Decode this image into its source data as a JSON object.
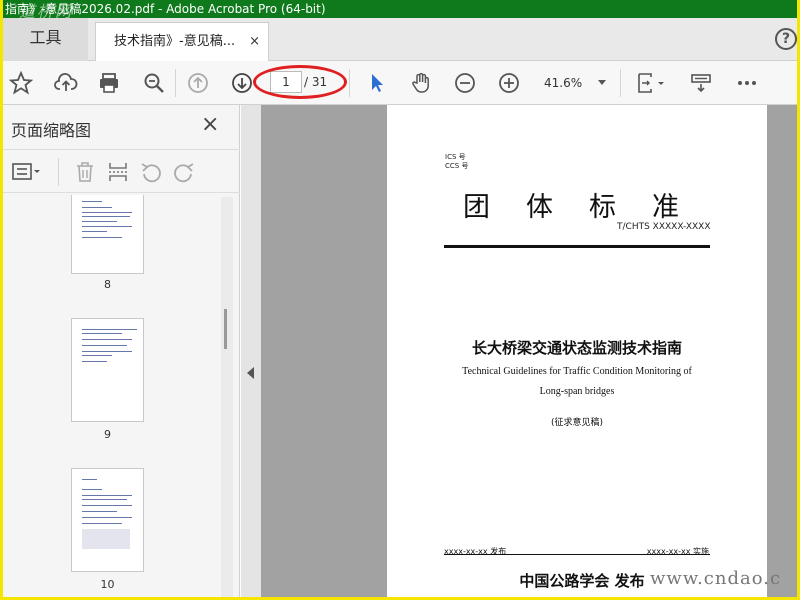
{
  "window": {
    "title": "指南》-意见稿2026.02.pdf - Adobe Acrobat Pro (64-bit)"
  },
  "watermark": {
    "top": "道桥网",
    "bottom": "www.cndao.c"
  },
  "tabs": {
    "tools": "工具",
    "document": "技术指南》-意见稿...",
    "close": "×",
    "help": "?"
  },
  "toolbar": {
    "page_current": "1",
    "page_total": "/ 31",
    "zoom": "41.6%",
    "icons": [
      "star-icon",
      "cloud-upload-icon",
      "print-icon",
      "zoom-out-search-icon",
      "prev-page-icon",
      "next-page-icon",
      "select-cursor-icon",
      "hand-icon",
      "zoom-out-icon",
      "zoom-in-icon",
      "fit-page-icon",
      "scroll-mode-icon",
      "more-icon"
    ]
  },
  "sidebar": {
    "title": "页面缩略图",
    "close": "×",
    "thumbnails": [
      {
        "label": "8"
      },
      {
        "label": "9"
      },
      {
        "label": "10"
      }
    ]
  },
  "document": {
    "ics": "ICS 号",
    "ccs": "CCS 号",
    "standard_title": "团体标准",
    "standard_code": "T/CHTS  XXXXX-XXXX",
    "title_cn": "长大桥梁交通状态监测技术指南",
    "title_en_line1": "Technical Guidelines for Traffic Condition Monitoring of",
    "title_en_line2": "Long-span bridges",
    "draft_note": "(征求意见稿)",
    "publish_date": "xxxx-xx-xx 发布",
    "effective_date": "xxxx-xx-xx 实施",
    "organization": "中国公路学会  发布"
  }
}
